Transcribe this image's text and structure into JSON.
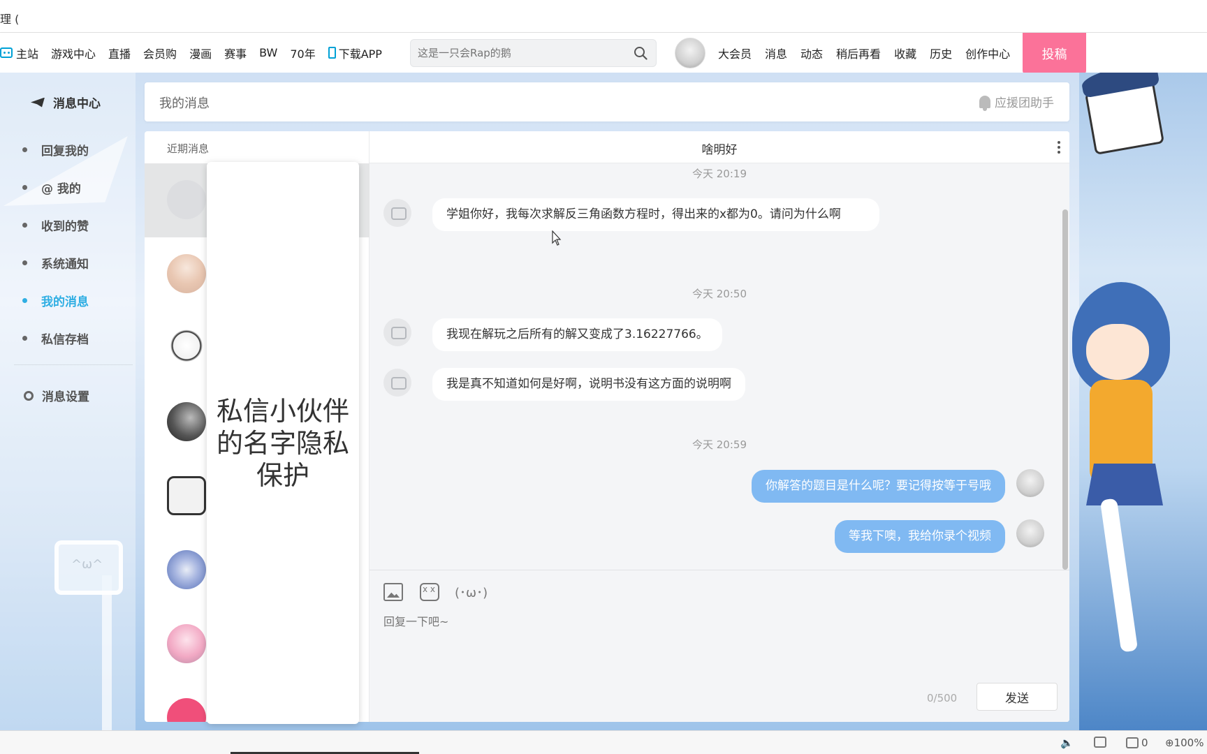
{
  "window": {
    "title_fragment": "理 ("
  },
  "nav": {
    "items": [
      {
        "label": "主站",
        "icon": "tv-icon"
      },
      {
        "label": "游戏中心"
      },
      {
        "label": "直播"
      },
      {
        "label": "会员购"
      },
      {
        "label": "漫画"
      },
      {
        "label": "赛事"
      },
      {
        "label": "BW"
      },
      {
        "label": "70年"
      },
      {
        "label": "下载APP",
        "icon": "phone-icon"
      }
    ],
    "search_placeholder": "这是一只会Rap的鹅",
    "right_items": [
      "大会员",
      "消息",
      "动态",
      "稍后再看",
      "收藏",
      "历史",
      "创作中心"
    ],
    "upload_label": "投稿",
    "accent": "#fb7299"
  },
  "sidebar": {
    "title": "消息中心",
    "items": [
      {
        "label": "回复我的",
        "active": false
      },
      {
        "label": "@ 我的",
        "active": false
      },
      {
        "label": "收到的赞",
        "active": false
      },
      {
        "label": "系统通知",
        "active": false
      },
      {
        "label": "我的消息",
        "active": true
      },
      {
        "label": "私信存档",
        "active": false
      }
    ],
    "settings_label": "消息设置",
    "active_color": "#2faee3"
  },
  "header": {
    "title": "我的消息",
    "helper_label": "应援团助手"
  },
  "contacts": {
    "recent_label": "近期消息",
    "privacy_notice": "私信小伙伴的名字隐私保护"
  },
  "conversation": {
    "partner_name": "啥明好",
    "messages": [
      {
        "time": "今天 20:19"
      },
      {
        "from": "them",
        "text": "学姐你好，我每次求解反三角函数方程时，得出来的x都为0。请问为什么啊"
      },
      {
        "time": "今天 20:50"
      },
      {
        "from": "them",
        "text": "我现在解玩之后所有的解又变成了3.16227766。"
      },
      {
        "from": "them",
        "text": "我是真不知道如何是好啊，说明书没有这方面的说明啊"
      },
      {
        "time": "今天 20:59"
      },
      {
        "from": "me",
        "text": "你解答的题目是什么呢？要记得按等于号哦"
      },
      {
        "from": "me",
        "text": "等我下噢，我给你录个视频"
      }
    ],
    "outgoing_color": "#80b9f2"
  },
  "composer": {
    "kaomoji": "(･ω･)",
    "placeholder": "回复一下吧~",
    "counter": "0/500",
    "send_label": "发送"
  },
  "statusbar": {
    "badge_count": "0",
    "zoom": "100%"
  }
}
